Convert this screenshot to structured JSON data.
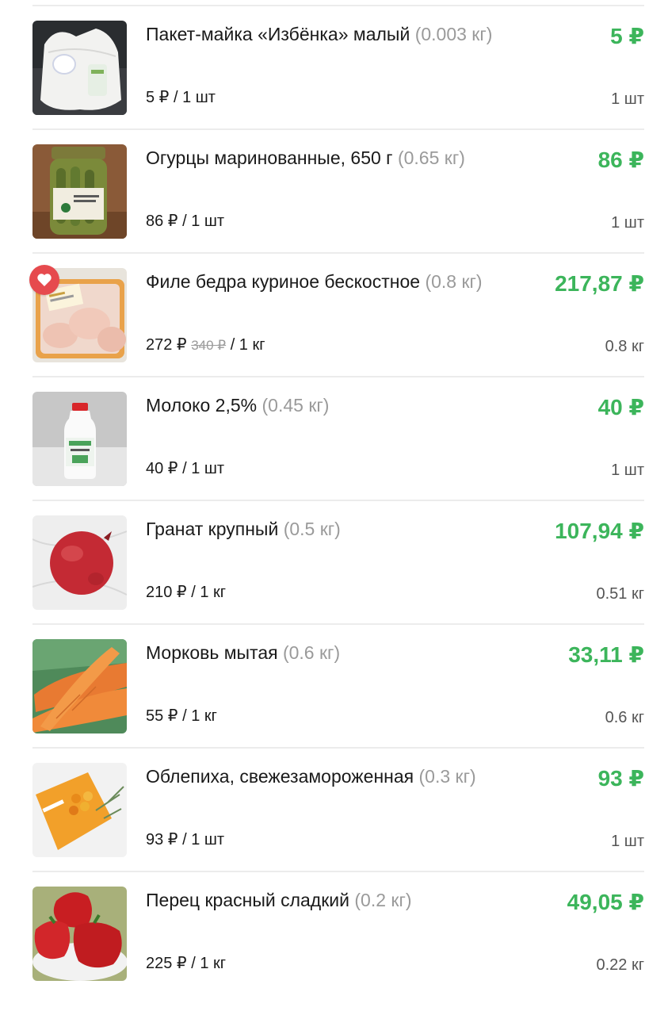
{
  "accent_color": "#3cb55b",
  "favorite_color": "#e64a4e",
  "items": [
    {
      "image": "plastic-bag",
      "name": "Пакет-майка «Избёнка» малый",
      "weight": "(0.003 кг)",
      "total": "5 ₽",
      "unit_price": "5 ₽ / 1 шт",
      "quantity": "1 шт"
    },
    {
      "image": "pickles-jar",
      "name": "Огурцы маринованные, 650 г",
      "weight": "(0.65 кг)",
      "total": "86 ₽",
      "unit_price": "86 ₽ / 1 шт",
      "quantity": "1 шт"
    },
    {
      "image": "chicken-thigh",
      "favorite_icon": "heart-icon",
      "name": "Филе бедра куриное бескостное",
      "weight": "(0.8 кг)",
      "total": "217,87 ₽",
      "price": "272 ₽",
      "old_price": "340 ₽",
      "per": "/ 1 кг",
      "quantity": "0.8 кг"
    },
    {
      "image": "milk-bottle",
      "name": "Молоко 2,5%",
      "weight": "(0.45 кг)",
      "total": "40 ₽",
      "unit_price": "40 ₽ / 1 шт",
      "quantity": "1 шт"
    },
    {
      "image": "pomegranate",
      "name": "Гранат крупный",
      "weight": "(0.5 кг)",
      "total": "107,94 ₽",
      "unit_price": "210 ₽ / 1 кг",
      "quantity": "0.51 кг"
    },
    {
      "image": "carrots",
      "name": "Морковь мытая",
      "weight": "(0.6 кг)",
      "total": "33,11 ₽",
      "unit_price": "55 ₽ / 1 кг",
      "quantity": "0.6 кг"
    },
    {
      "image": "sea-buckthorn-pack",
      "name": "Облепиха, свежезамороженная",
      "weight": "(0.3 кг)",
      "total": "93 ₽",
      "unit_price": "93 ₽ / 1 шт",
      "quantity": "1 шт"
    },
    {
      "image": "red-peppers",
      "name": "Перец красный сладкий",
      "weight": "(0.2 кг)",
      "total": "49,05 ₽",
      "unit_price": "225 ₽ / 1 кг",
      "quantity": "0.22 кг"
    }
  ]
}
